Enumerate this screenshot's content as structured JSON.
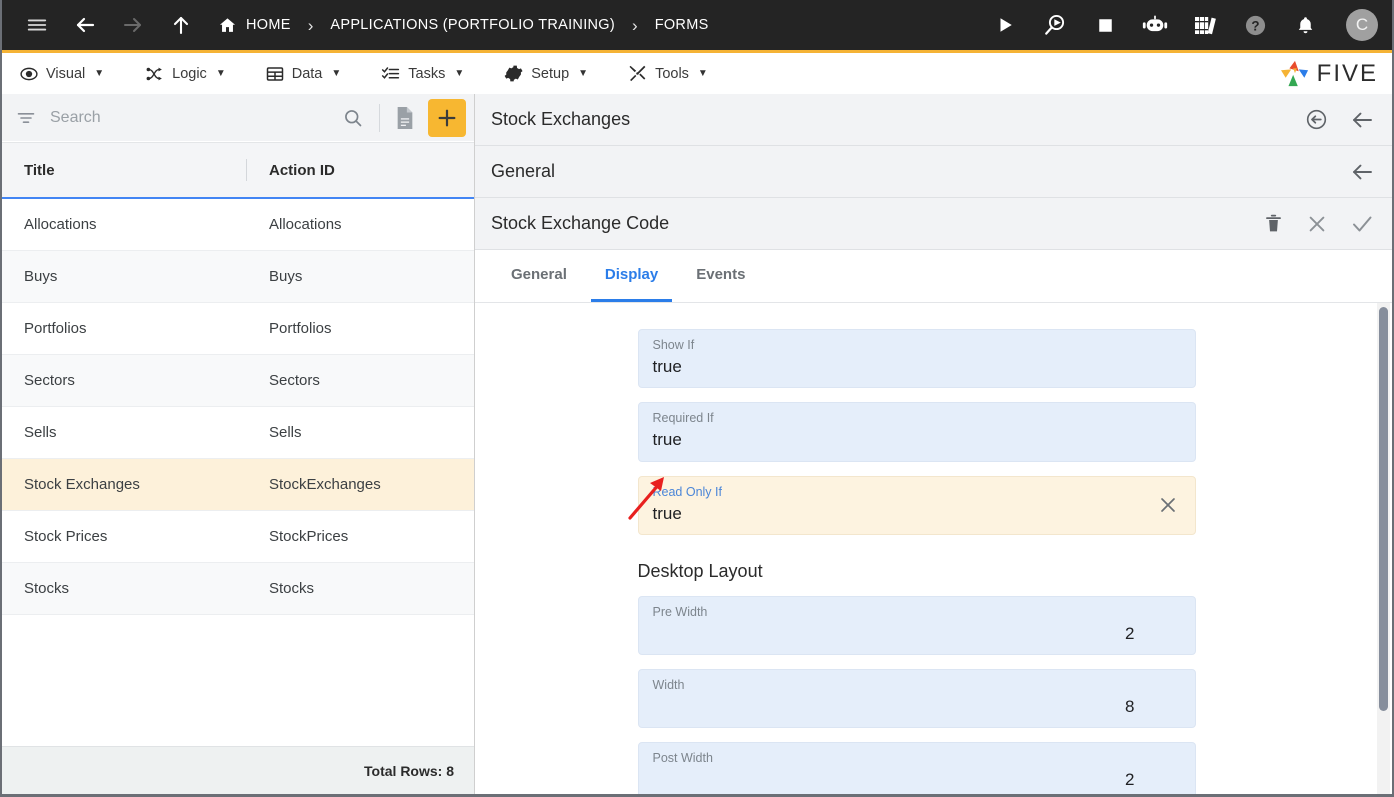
{
  "topbar": {
    "icons": [
      {
        "name": "hamburger-menu-icon",
        "label": "Menu"
      },
      {
        "name": "back-arrow-icon",
        "label": "Back"
      },
      {
        "name": "forward-arrow-icon",
        "label": "Forward"
      },
      {
        "name": "up-arrow-icon",
        "label": "Up"
      }
    ],
    "breadcrumb": [
      {
        "label": "HOME",
        "icon": "home-icon"
      },
      {
        "label": "APPLICATIONS (PORTFOLIO TRAINING)"
      },
      {
        "label": "FORMS"
      }
    ],
    "separator": "›",
    "right_icons": [
      {
        "name": "run-play-icon"
      },
      {
        "name": "debug-search-play-icon"
      },
      {
        "name": "stop-square-icon"
      },
      {
        "name": "chat-bot-icon"
      },
      {
        "name": "books-library-icon"
      },
      {
        "name": "help-question-icon"
      },
      {
        "name": "notification-bell-icon"
      }
    ],
    "avatar_initial": "C",
    "avatar_color": "#a0a0a0",
    "background": "#242424"
  },
  "menubar": {
    "accent_bar_color": "#f5b335",
    "items": [
      {
        "label": "Visual",
        "icon": "eye-icon",
        "caret": "▼"
      },
      {
        "label": "Logic",
        "icon": "nodes-icon",
        "caret": "▼"
      },
      {
        "label": "Data",
        "icon": "table-icon",
        "caret": "▼"
      },
      {
        "label": "Tasks",
        "icon": "checklist-icon",
        "caret": "▼"
      },
      {
        "label": "Setup",
        "icon": "gear-icon",
        "caret": "▼"
      },
      {
        "label": "Tools",
        "icon": "tools-icon",
        "caret": "▼"
      }
    ],
    "logo_text": "FIVE"
  },
  "left_panel": {
    "search": {
      "placeholder": "Search",
      "value": ""
    },
    "toolbar_icons": [
      {
        "name": "filter-icon"
      },
      {
        "name": "search-icon"
      },
      {
        "name": "document-icon"
      },
      {
        "name": "add-plus-button",
        "color": "#f7b731"
      }
    ],
    "grid": {
      "columns": [
        "Title",
        "Action ID"
      ],
      "rows": [
        {
          "title": "Allocations",
          "action_id": "Allocations",
          "selected": false
        },
        {
          "title": "Buys",
          "action_id": "Buys",
          "selected": false
        },
        {
          "title": "Portfolios",
          "action_id": "Portfolios",
          "selected": false
        },
        {
          "title": "Sectors",
          "action_id": "Sectors",
          "selected": false
        },
        {
          "title": "Sells",
          "action_id": "Sells",
          "selected": false
        },
        {
          "title": "Stock Exchanges",
          "action_id": "StockExchanges",
          "selected": true
        },
        {
          "title": "Stock Prices",
          "action_id": "StockPrices",
          "selected": false
        },
        {
          "title": "Stocks",
          "action_id": "Stocks",
          "selected": false
        }
      ],
      "footer": "Total Rows: 8",
      "selected_row_color": "#fdf1da",
      "header_underline_color": "#4285f4"
    }
  },
  "right_panel": {
    "headers": [
      {
        "title": "Stock Exchanges",
        "icons": [
          "revert-circle-arrow-icon",
          "back-arrow-icon"
        ]
      },
      {
        "title": "General",
        "icons": [
          "back-arrow-icon"
        ]
      },
      {
        "title": "Stock Exchange Code",
        "icons": [
          "delete-trash-icon",
          "close-x-icon",
          "save-check-icon"
        ]
      }
    ],
    "tabs": [
      {
        "label": "General",
        "active": false
      },
      {
        "label": "Display",
        "active": true
      },
      {
        "label": "Events",
        "active": false
      }
    ],
    "active_tab_color": "#2b7de9",
    "fields": [
      {
        "label": "Show If",
        "value": "true",
        "highlight": false,
        "clearable": false,
        "numeric": false
      },
      {
        "label": "Required If",
        "value": "true",
        "highlight": false,
        "clearable": false,
        "numeric": false
      },
      {
        "label": "Read Only If",
        "value": "true",
        "highlight": true,
        "clearable": true,
        "numeric": false
      }
    ],
    "section": {
      "title": "Desktop Layout",
      "fields": [
        {
          "label": "Pre Width",
          "value": "2",
          "highlight": false,
          "clearable": false,
          "numeric": true
        },
        {
          "label": "Width",
          "value": "8",
          "highlight": false,
          "clearable": false,
          "numeric": true
        },
        {
          "label": "Post Width",
          "value": "2",
          "highlight": false,
          "clearable": false,
          "numeric": true
        }
      ]
    }
  },
  "annotation": {
    "arrow_color": "#e8201f",
    "points_to": "Read Only If"
  }
}
